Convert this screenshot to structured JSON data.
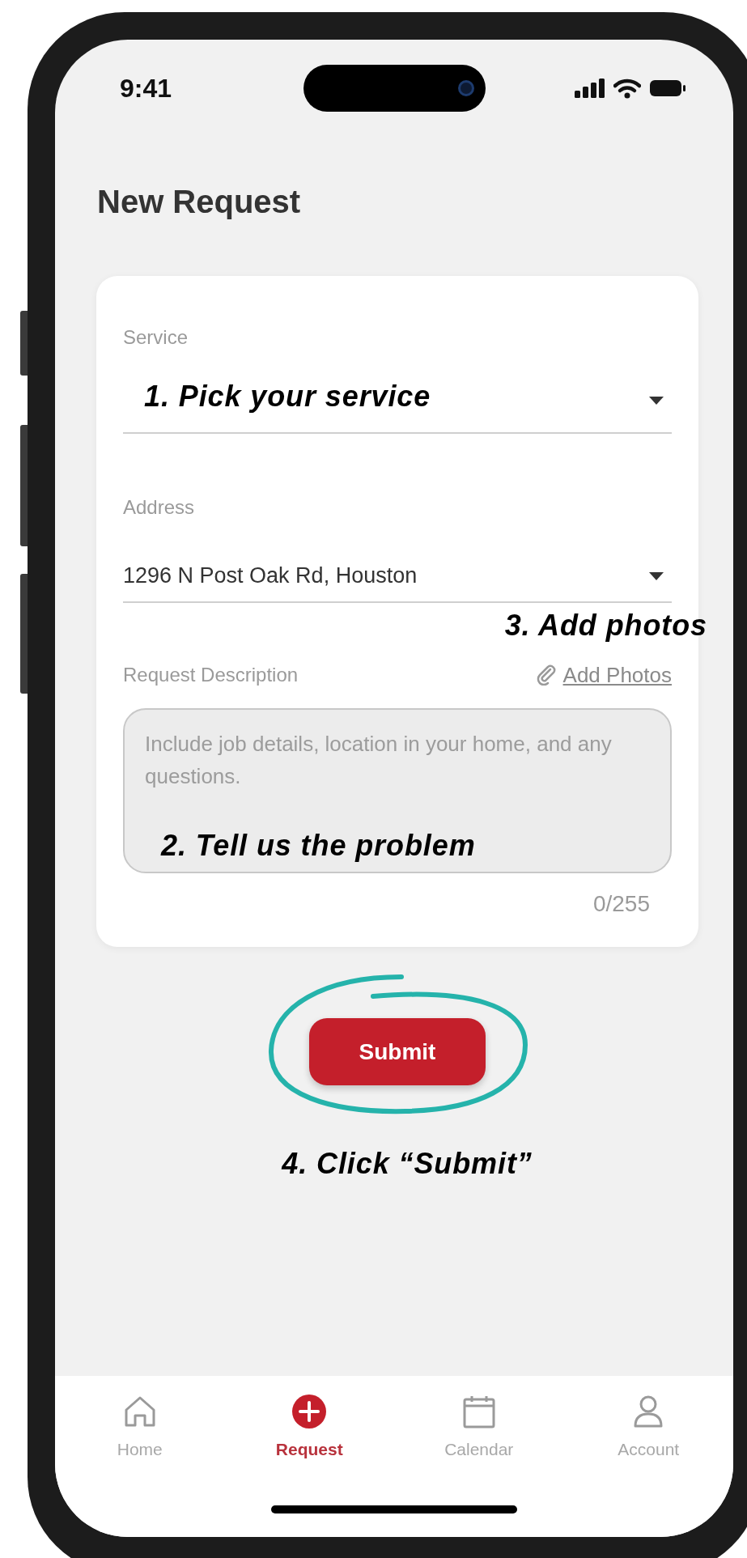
{
  "status_bar": {
    "time": "9:41"
  },
  "screen_title": "New Request",
  "form": {
    "service": {
      "label": "Service",
      "annotation": "1. Pick your service"
    },
    "address": {
      "label": "Address",
      "value": "1296 N Post Oak Rd, Houston",
      "annotation": "3. Add photos"
    },
    "description": {
      "label": "Request Description",
      "add_photos": "Add Photos",
      "placeholder": "Include job details, location in your home, and any questions.",
      "annotation": "2. Tell us the problem",
      "counter": "0/255"
    }
  },
  "submit": {
    "label": "Submit",
    "annotation": "4. Click “Submit”"
  },
  "tab_bar": [
    {
      "label": "Home",
      "selected": false
    },
    {
      "label": "Request",
      "selected": true
    },
    {
      "label": "Calendar",
      "selected": false
    },
    {
      "label": "Account",
      "selected": false
    }
  ]
}
